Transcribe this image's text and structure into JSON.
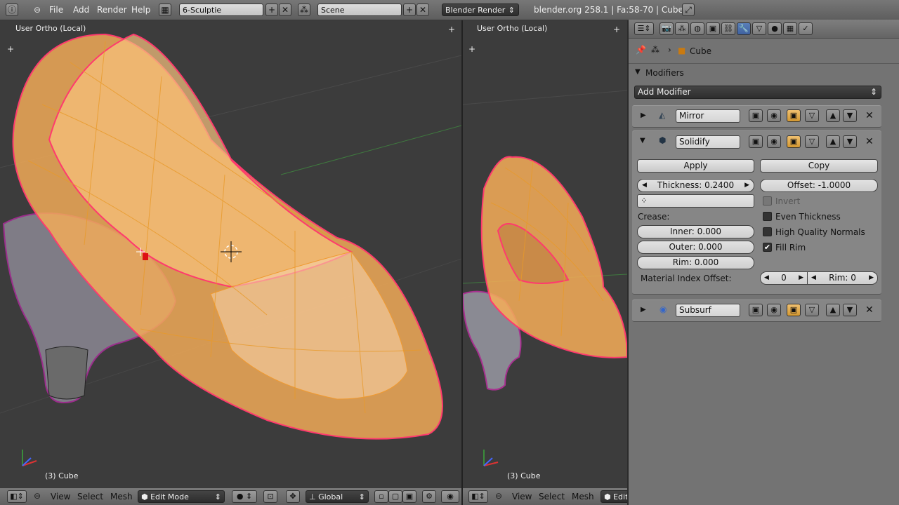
{
  "topbar": {
    "menus": [
      "File",
      "Add",
      "Render",
      "Help"
    ],
    "screen_layout": "6-Sculptie",
    "scene": "Scene",
    "render_engine": "Blender Render",
    "stats": "blender.org 258.1 | Fa:58-70 | Cube"
  },
  "left_view": {
    "label": "User Ortho (Local)",
    "object_info": "(3) Cube",
    "menus": [
      "View",
      "Select",
      "Mesh"
    ],
    "mode": "Edit Mode",
    "orientation": "Global"
  },
  "right_view": {
    "label": "User Ortho (Local)",
    "object_info": "(3) Cube",
    "menus": [
      "View",
      "Select",
      "Mesh"
    ],
    "mode_partial": "Edit"
  },
  "properties": {
    "breadcrumb": "Cube",
    "section_title": "Modifiers",
    "add_modifier": "Add Modifier",
    "modifiers": [
      {
        "name": "Mirror",
        "expanded": false
      },
      {
        "name": "Solidify",
        "expanded": true
      },
      {
        "name": "Subsurf",
        "expanded": false
      }
    ],
    "solidify": {
      "apply": "Apply",
      "copy": "Copy",
      "thickness": "Thickness: 0.2400",
      "offset": "Offset: -1.0000",
      "invert": "Invert",
      "crease_label": "Crease:",
      "inner": "Inner: 0.000",
      "outer": "Outer: 0.000",
      "rim": "Rim: 0.000",
      "even_thickness": "Even Thickness",
      "high_quality_normals": "High Quality Normals",
      "fill_rim": "Fill Rim",
      "fill_rim_checked": true,
      "material_index_offset": "Material Index Offset:",
      "mat_offset_value": "0",
      "rim_offset": "Rim: 0"
    }
  },
  "colors": {
    "viewport_bg": "#3c3c3c",
    "selection_edge": "#ff3a6e",
    "mesh_orange": "#f7a63a"
  }
}
